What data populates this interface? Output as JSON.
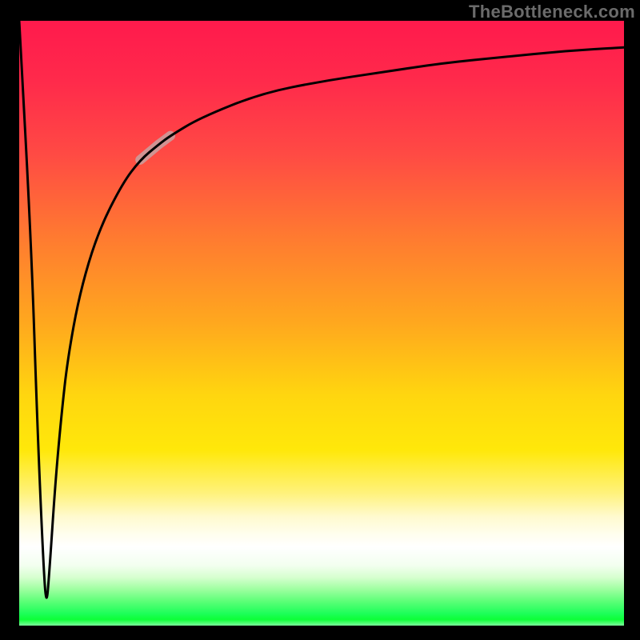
{
  "watermark": "TheBottleneck.com",
  "chart_data": {
    "type": "line",
    "title": "",
    "xlabel": "",
    "ylabel": "",
    "xlim": [
      0,
      100
    ],
    "ylim": [
      0,
      100
    ],
    "grid": false,
    "legend": false,
    "annotations": [],
    "series": [
      {
        "name": "curve",
        "x": [
          0,
          2,
          3,
          4,
          4.5,
          5,
          6,
          7,
          8,
          10,
          13,
          17,
          20,
          23,
          25,
          30,
          40,
          50,
          60,
          70,
          80,
          90,
          100
        ],
        "values": [
          100,
          63,
          33,
          10,
          3,
          9,
          24,
          35,
          44,
          55,
          65,
          73,
          77,
          79.5,
          81,
          84,
          88,
          90,
          91.5,
          93,
          94,
          95,
          95.6
        ]
      }
    ],
    "highlight": {
      "x_start": 20,
      "x_end": 25
    }
  }
}
